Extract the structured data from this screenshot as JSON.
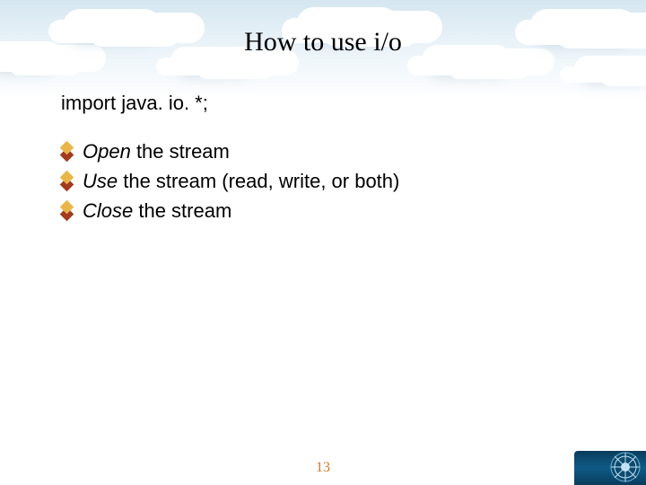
{
  "title": "How to use i/o",
  "intro": "import java. io. *;",
  "bullets": [
    {
      "em": "Open",
      "rest": " the stream"
    },
    {
      "em": "Use",
      "rest": " the stream (read, write, or both)"
    },
    {
      "em": "Close",
      "rest": " the stream"
    }
  ],
  "page_number": "13"
}
